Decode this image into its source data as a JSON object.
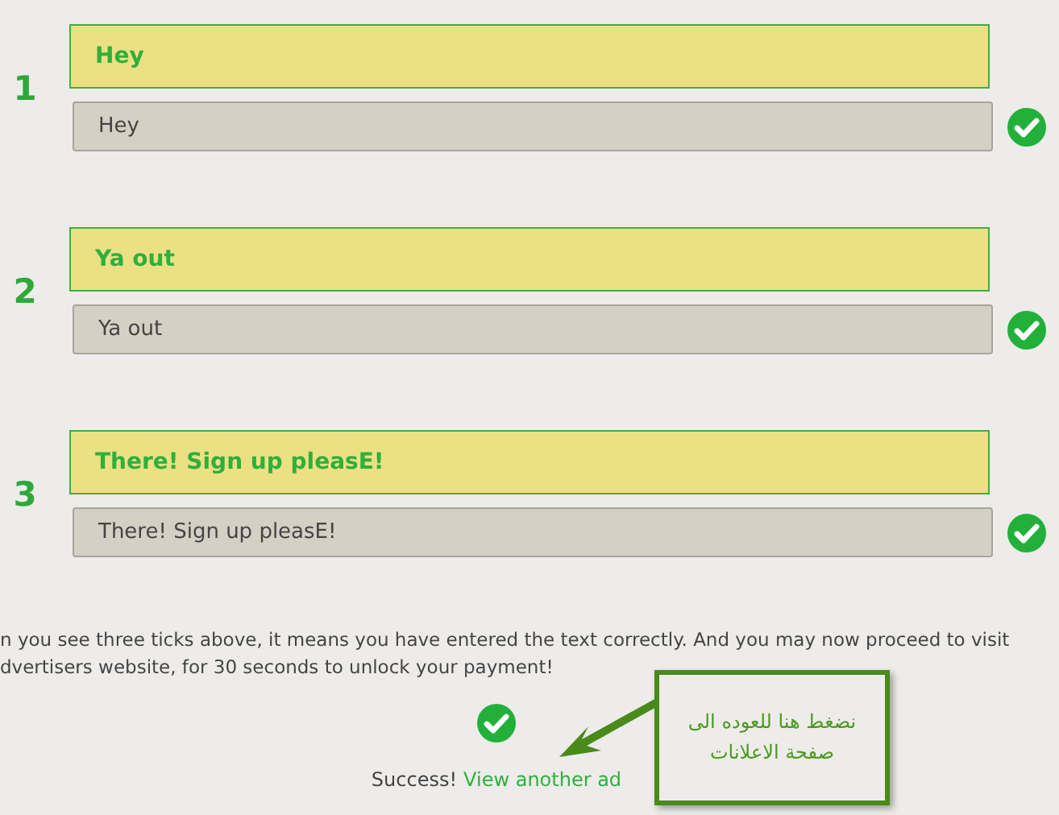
{
  "entries": [
    {
      "number": "1",
      "prompt": "Hey",
      "answer": "Hey",
      "correct": true
    },
    {
      "number": "2",
      "prompt": "Ya out",
      "answer": "Ya out",
      "correct": true
    },
    {
      "number": "3",
      "prompt": "There! Sign up pleasE!",
      "answer": "There! Sign up pleasE!",
      "correct": true
    }
  ],
  "message_lines": [
    "n you see three ticks above, it means you have entered the text correctly. And you may now proceed to visit",
    "dvertisers website, for 30 seconds to unlock your payment!"
  ],
  "success": {
    "label": "Success!",
    "link": "View another ad"
  },
  "annotation": {
    "lines": [
      "نضغط هنا للعوده الى",
      "صفحة الاعلانات"
    ]
  }
}
